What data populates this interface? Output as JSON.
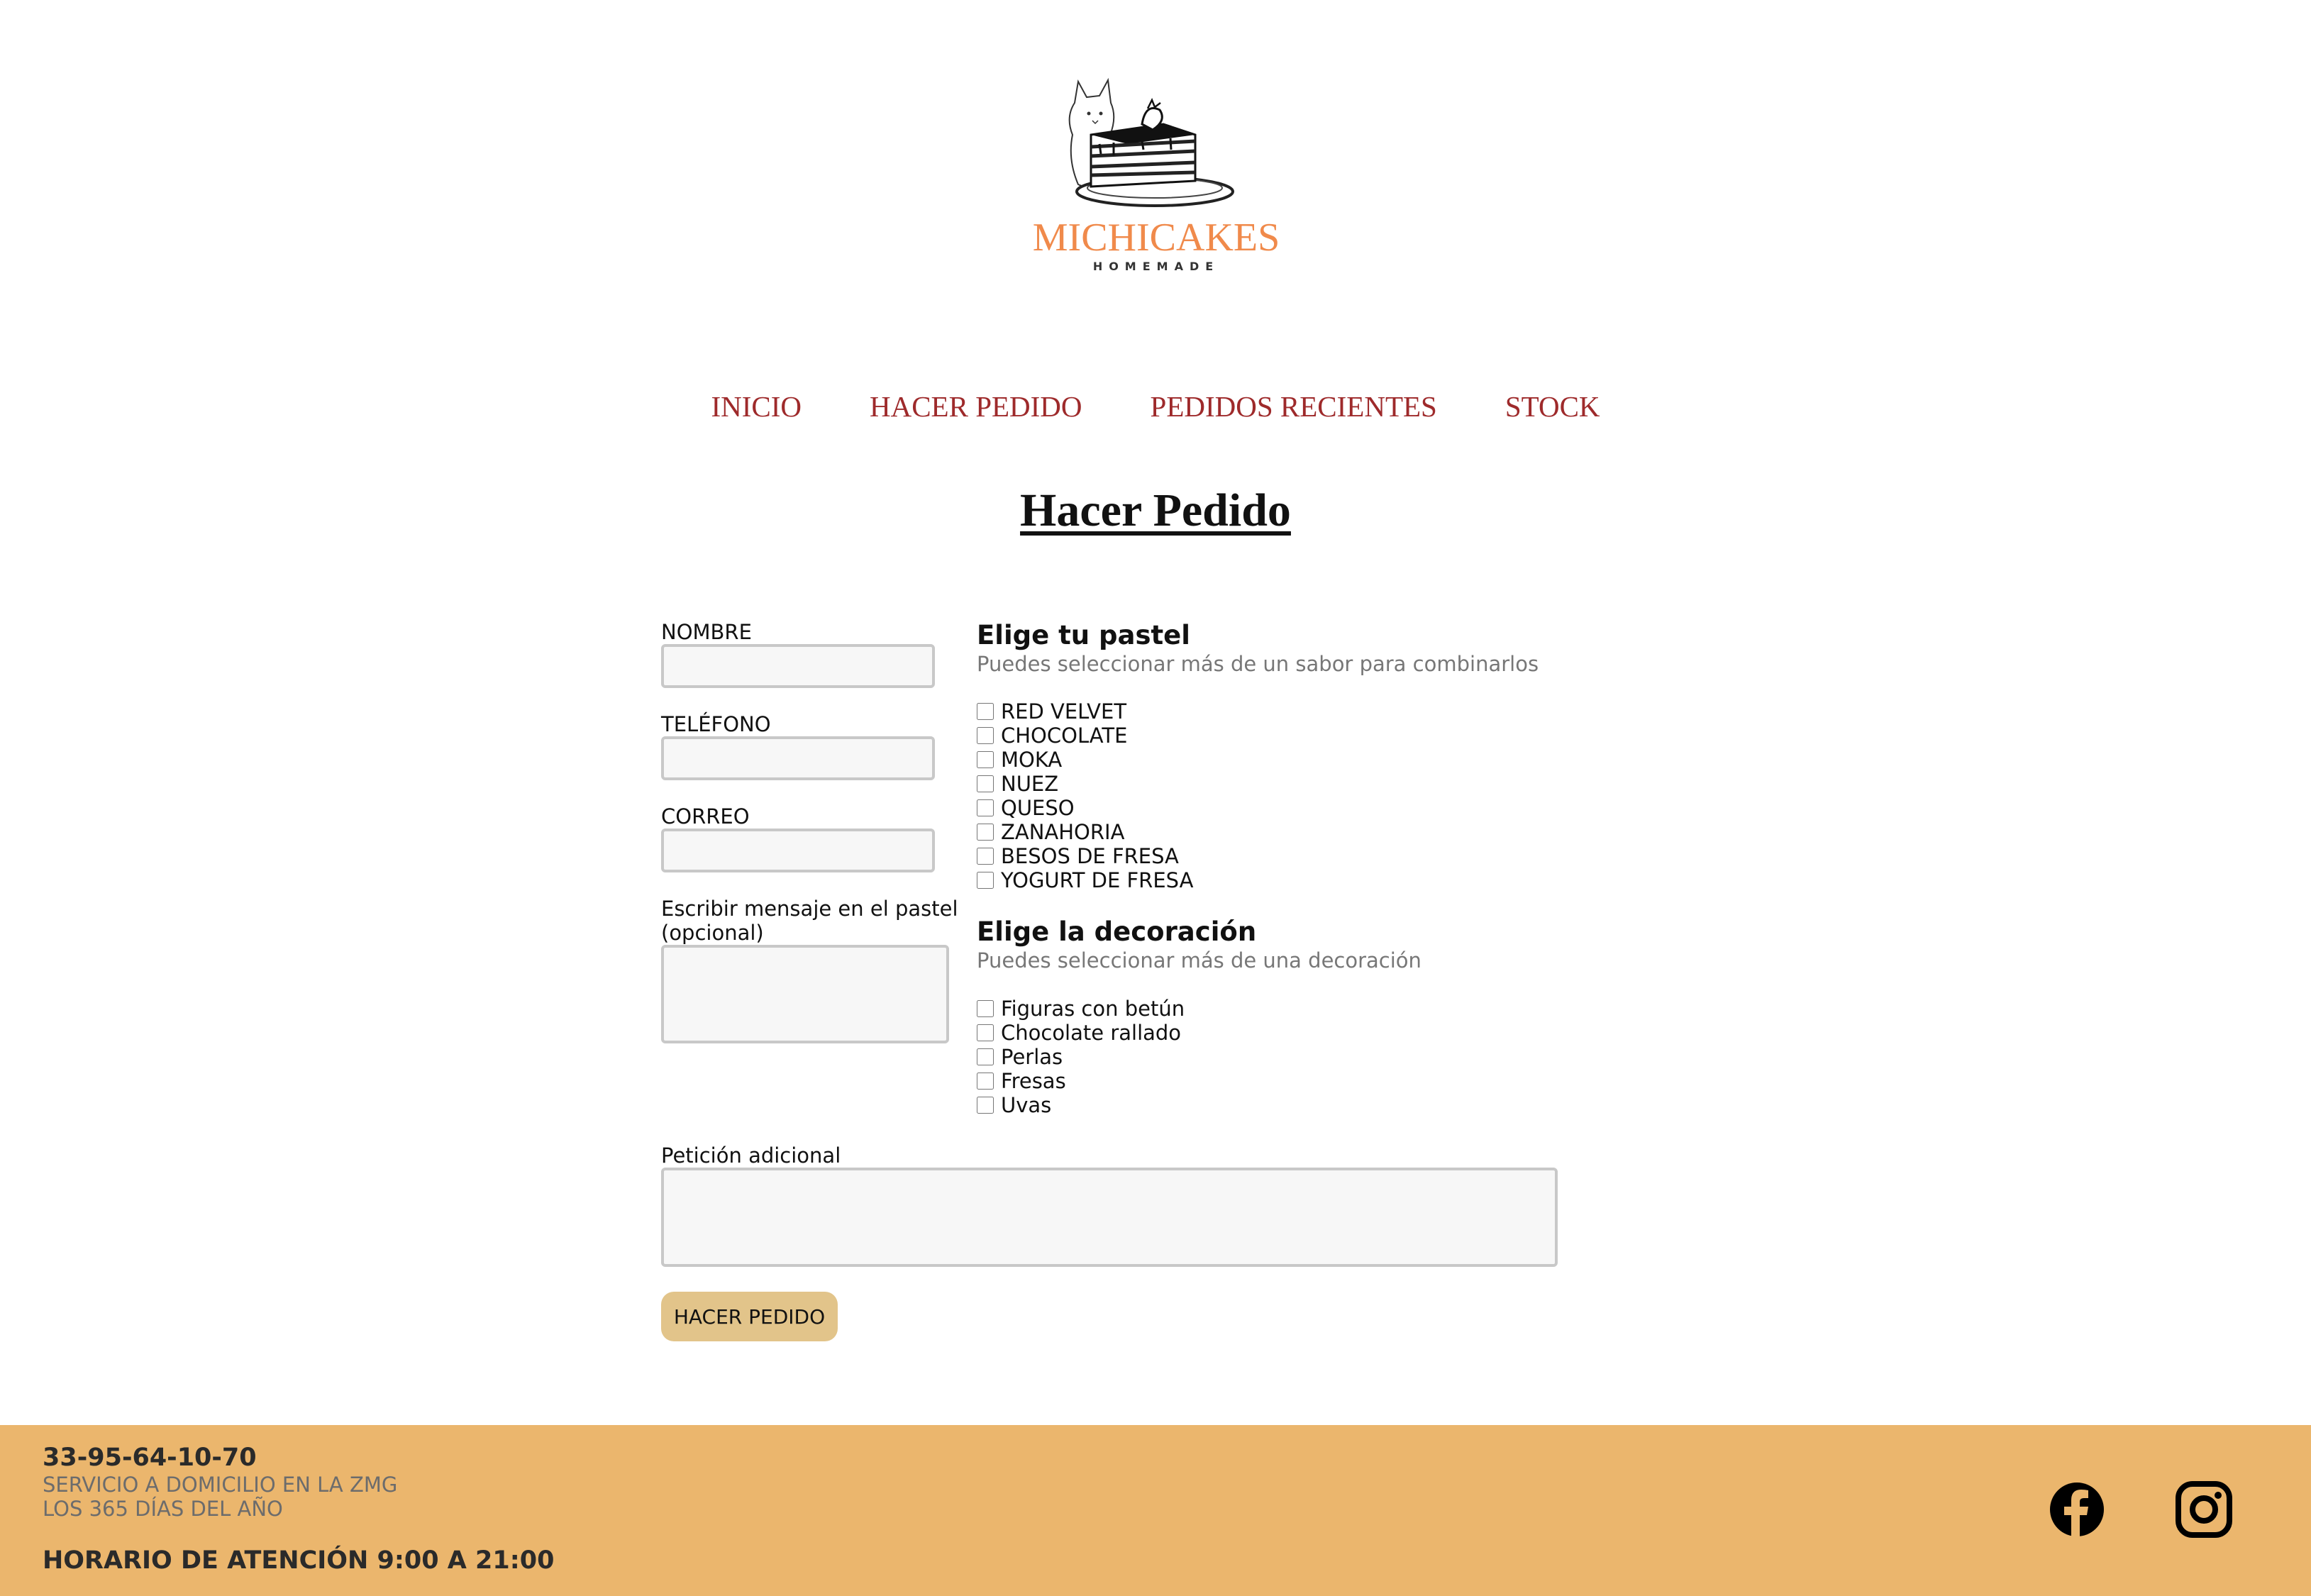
{
  "logo": {
    "brand": "MICHICAKES",
    "tagline": "HOMEMADE"
  },
  "nav": [
    "INICIO",
    "HACER PEDIDO",
    "PEDIDOS RECIENTES",
    "STOCK"
  ],
  "page_title": "Hacer Pedido",
  "form": {
    "nombre_label": "NOMBRE",
    "telefono_label": "TELÉFONO",
    "correo_label": "CORREO",
    "mensaje_label_1": "Escribir mensaje en el pastel",
    "mensaje_label_2": "(opcional)",
    "peticion_label": "Petición adicional",
    "submit_label": "HACER PEDIDO"
  },
  "pastel": {
    "heading": "Elige tu pastel",
    "hint": "Puedes seleccionar más de un sabor para combinarlos",
    "options": [
      "RED VELVET",
      "CHOCOLATE",
      "MOKA",
      "NUEZ",
      "QUESO",
      "ZANAHORIA",
      "BESOS DE FRESA",
      "YOGURT DE FRESA"
    ]
  },
  "decoracion": {
    "heading": "Elige la decoración",
    "hint": "Puedes seleccionar más de una decoración",
    "options": [
      "Figuras con betún",
      "Chocolate rallado",
      "Perlas",
      "Fresas",
      "Uvas"
    ]
  },
  "footer": {
    "phone": "33-95-64-10-70",
    "line1": "SERVICIO A DOMICILIO EN LA ZMG",
    "line2": "LOS 365 DÍAS DEL AÑO",
    "hours": "HORARIO DE ATENCIÓN 9:00 A 21:00"
  },
  "colors": {
    "nav": "#9e2a2b",
    "brand": "#f08a4b",
    "footer_bg": "#ebb66d",
    "button_bg": "#e2c48a"
  },
  "icons": [
    "facebook-icon",
    "instagram-icon"
  ]
}
